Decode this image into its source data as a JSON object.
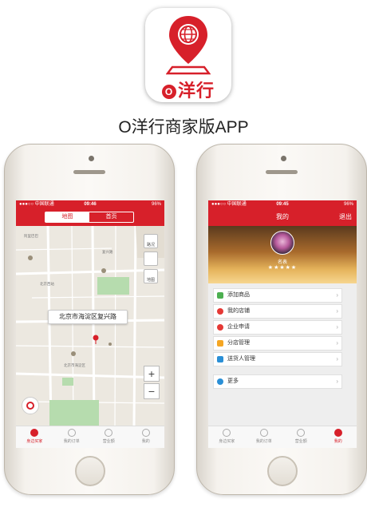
{
  "app": {
    "icon_brand_text": "洋行",
    "icon_brand_o": "O",
    "title": "O洋行商家版APP"
  },
  "status_bar": {
    "carrier": "●●●○○ 中国联通",
    "left_time": "09:46",
    "right_time": "09:45",
    "battery": "96%"
  },
  "map_screen": {
    "segment": {
      "map_label": "地图",
      "home_label": "首页"
    },
    "callout": "北京市海淀区复兴路",
    "side_buttons": [
      "路况",
      "",
      "地图"
    ],
    "zoom_in": "+",
    "zoom_out": "−",
    "labels": [
      "阿里巴巴",
      "复兴路",
      "北京西站",
      "北京市海淀区"
    ],
    "tabs": [
      {
        "label": "身边买家",
        "icon": "location-pin-icon"
      },
      {
        "label": "我的订单",
        "icon": "order-icon"
      },
      {
        "label": "营业额",
        "icon": "money-icon"
      },
      {
        "label": "我的",
        "icon": "user-icon"
      }
    ],
    "active_tab": 0
  },
  "profile_screen": {
    "header_title": "我的",
    "logout": "退出",
    "name": "名表",
    "stars": "★★★★★",
    "menu": [
      {
        "label": "添加商品",
        "icon": "add-icon",
        "color": "#4caf50"
      },
      {
        "label": "我的店铺",
        "icon": "store-icon",
        "color": "#e53935"
      },
      {
        "label": "企业申请",
        "icon": "apply-icon",
        "color": "#e53935"
      },
      {
        "label": "分店管理",
        "icon": "branch-icon",
        "color": "#f5a623"
      },
      {
        "label": "送货人管理",
        "icon": "courier-icon",
        "color": "#2a8fd6"
      },
      {
        "label": "更多",
        "icon": "more-icon",
        "color": "#2a8fd6"
      }
    ],
    "arrow": "›",
    "tabs": [
      {
        "label": "身边买家",
        "icon": "location-pin-icon"
      },
      {
        "label": "我的订单",
        "icon": "order-icon"
      },
      {
        "label": "营业额",
        "icon": "money-icon"
      },
      {
        "label": "我的",
        "icon": "user-icon"
      }
    ],
    "active_tab": 3
  },
  "colors": {
    "brand": "#d7202a",
    "map_bg": "#ece8e0",
    "park": "#b6dcae"
  }
}
